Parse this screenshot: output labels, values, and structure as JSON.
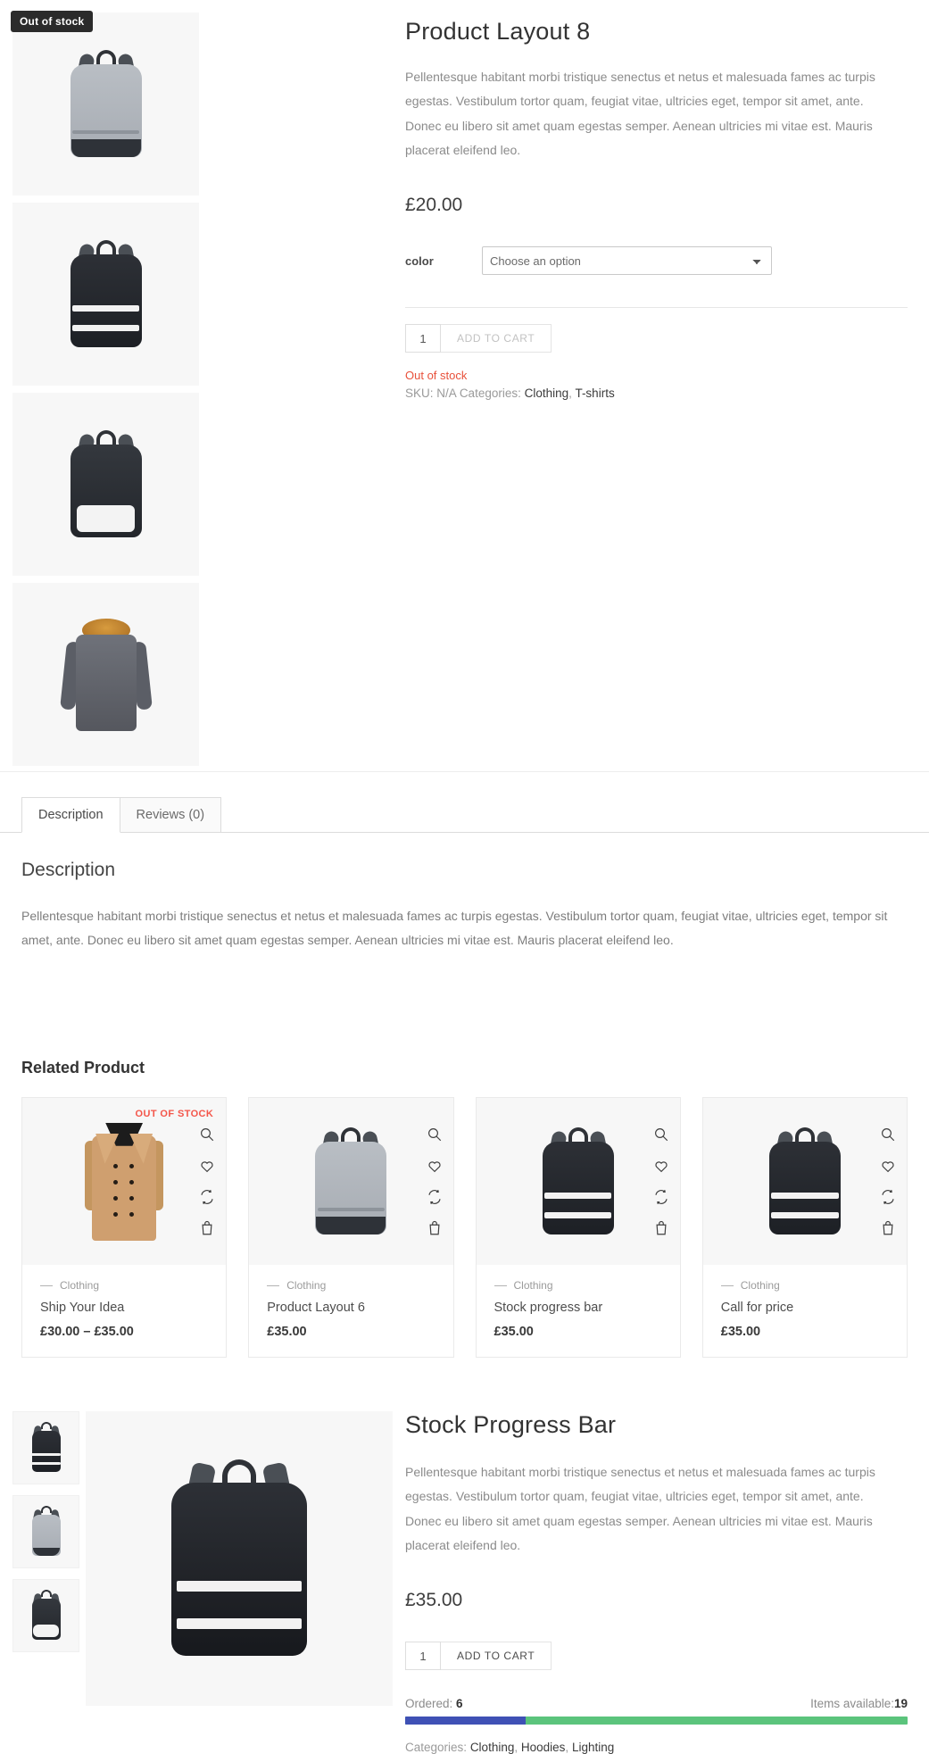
{
  "top_product": {
    "badge": "Out of stock",
    "title": "Product Layout 8",
    "short_description": "Pellentesque habitant morbi tristique senectus et netus et malesuada fames ac turpis egestas. Vestibulum tortor quam, feugiat vitae, ultricies eget, tempor sit amet, ante. Donec eu libero sit amet quam egestas semper. Aenean ultricies mi vitae est. Mauris placerat eleifend leo.",
    "price": "£20.00",
    "variation_label": "color",
    "variation_selected": "Choose an option",
    "variation_options": [
      "Choose an option"
    ],
    "qty_value": "1",
    "add_to_cart_label": "ADD TO CART",
    "stock_status": "Out of stock",
    "sku_label": "SKU:",
    "sku_value": "N/A",
    "categories_label": "Categories:",
    "categories": [
      "Clothing",
      "T-shirts"
    ],
    "meta_line": "SKU: N/A Categories: Clothing, T-shirts"
  },
  "tabs": {
    "items": [
      {
        "label": "Description",
        "active": true
      },
      {
        "label": "Reviews (0)",
        "active": false
      }
    ],
    "panel_heading": "Description",
    "panel_text": "Pellentesque habitant morbi tristique senectus et netus et malesuada fames ac turpis egestas. Vestibulum tortor quam, feugiat vitae, ultricies eget, tempor sit amet, ante. Donec eu libero sit amet quam egestas semper. Aenean ultricies mi vitae est. Mauris placerat eleifend leo."
  },
  "related": {
    "heading": "Related Product",
    "action_icons": [
      "search-icon",
      "heart-icon",
      "compare-icon",
      "cart-icon"
    ],
    "cards": [
      {
        "badge": "OUT OF STOCK",
        "category": "Clothing",
        "name": "Ship Your Idea",
        "price": "£30.00 – £35.00",
        "art": "coat"
      },
      {
        "badge": "",
        "category": "Clothing",
        "name": "Product Layout 6",
        "price": "£35.00",
        "art": "bp-grey"
      },
      {
        "badge": "",
        "category": "Clothing",
        "name": "Stock progress bar",
        "price": "£35.00",
        "art": "bp-black"
      },
      {
        "badge": "",
        "category": "Clothing",
        "name": "Call for price",
        "price": "£35.00",
        "art": "bp-black"
      }
    ]
  },
  "bottom_product": {
    "title": "Stock Progress Bar",
    "short_description": "Pellentesque habitant morbi tristique senectus et netus et malesuada fames ac turpis egestas. Vestibulum tortor quam, feugiat vitae, ultricies eget, tempor sit amet, ante. Donec eu libero sit amet quam egestas semper. Aenean ultricies mi vitae est. Mauris placerat eleifend leo.",
    "price": "£35.00",
    "qty_value": "1",
    "add_to_cart_label": "ADD TO CART",
    "ordered_label": "Ordered:",
    "ordered_value": "6",
    "available_label": "Items available:",
    "available_value": "19",
    "progress_percent": 24,
    "progress_ordered_color": "#3f51b5",
    "progress_available_color": "#5bc47c",
    "categories_label": "Categories:",
    "categories": [
      "Clothing",
      "Hoodies",
      "Lighting"
    ],
    "categories_line": "Categories: Clothing, Hoodies, Lighting"
  },
  "colors": {
    "out_of_stock_red": "#e8503a",
    "badge_dark": "#2b2b2b",
    "card_badge_red": "#f4564a"
  }
}
